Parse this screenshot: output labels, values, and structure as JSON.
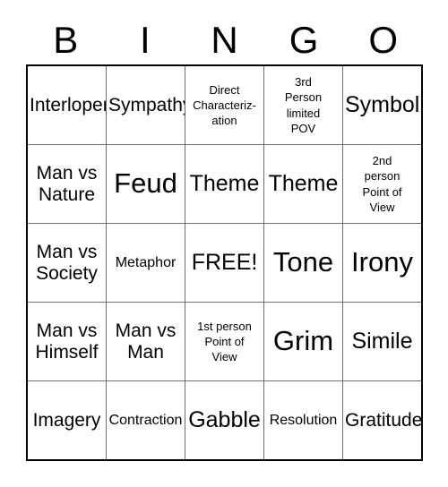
{
  "card": {
    "title_letters": [
      "B",
      "I",
      "N",
      "G",
      "O"
    ],
    "rows": [
      [
        {
          "text": "Interloper",
          "size": "md"
        },
        {
          "text": "Sympathy",
          "size": "md"
        },
        {
          "text": "Direct\nCharacteriz-\nation",
          "size": "xs"
        },
        {
          "text": "3rd\nPerson\nlimited\nPOV",
          "size": "xs"
        },
        {
          "text": "Symbol",
          "size": "lg"
        }
      ],
      [
        {
          "text": "Man vs\nNature",
          "size": "md"
        },
        {
          "text": "Feud",
          "size": "xl"
        },
        {
          "text": "Theme",
          "size": "lg"
        },
        {
          "text": "Theme",
          "size": "lg"
        },
        {
          "text": "2nd\nperson\nPoint of\nView",
          "size": "xs"
        }
      ],
      [
        {
          "text": "Man vs\nSociety",
          "size": "md"
        },
        {
          "text": "Metaphor",
          "size": "sm"
        },
        {
          "text": "FREE!",
          "size": "lg"
        },
        {
          "text": "Tone",
          "size": "xl"
        },
        {
          "text": "Irony",
          "size": "xl"
        }
      ],
      [
        {
          "text": "Man vs\nHimself",
          "size": "md"
        },
        {
          "text": "Man vs\nMan",
          "size": "md"
        },
        {
          "text": "1st person\nPoint of\nView",
          "size": "xs"
        },
        {
          "text": "Grim",
          "size": "xl"
        },
        {
          "text": "Simile",
          "size": "lg"
        }
      ],
      [
        {
          "text": "Imagery",
          "size": "md"
        },
        {
          "text": "Contraction",
          "size": "sm"
        },
        {
          "text": "Gabble",
          "size": "lg"
        },
        {
          "text": "Resolution",
          "size": "sm"
        },
        {
          "text": "Gratitude",
          "size": "md"
        }
      ]
    ],
    "free_space": "FREE!",
    "colors": {
      "background": "#ffffff",
      "text": "#000000",
      "outer_border": "#000000",
      "inner_grid_line": "#6b6b6b"
    }
  }
}
